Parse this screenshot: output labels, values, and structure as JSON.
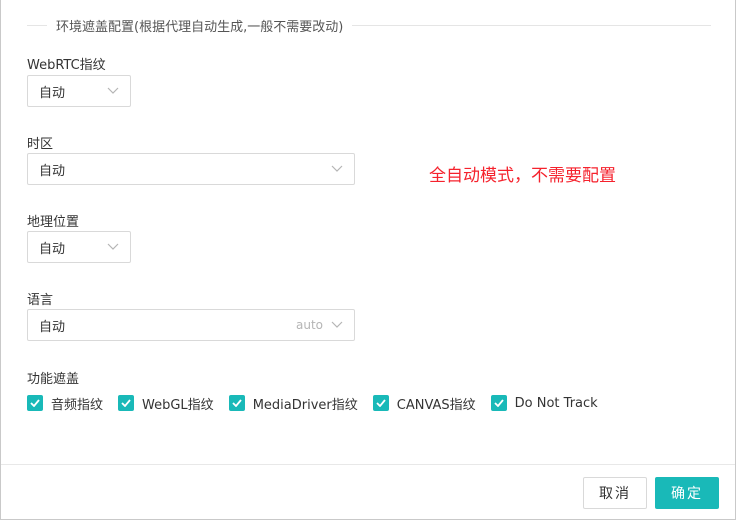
{
  "section": {
    "title": "环境遮盖配置(根据代理自动生成,一般不需要改动)"
  },
  "fields": {
    "webrtc": {
      "label": "WebRTC指纹",
      "value": "自动"
    },
    "timezone": {
      "label": "时区",
      "value": "自动"
    },
    "geo": {
      "label": "地理位置",
      "value": "自动"
    },
    "language": {
      "label": "语言",
      "value": "自动",
      "suffix": "auto"
    }
  },
  "note": "全自动模式，不需要配置",
  "features": {
    "label": "功能遮盖",
    "items": [
      {
        "label": "音频指纹",
        "checked": true
      },
      {
        "label": "WebGL指纹",
        "checked": true
      },
      {
        "label": "MediaDriver指纹",
        "checked": true
      },
      {
        "label": "CANVAS指纹",
        "checked": true
      },
      {
        "label": "Do Not Track",
        "checked": true
      }
    ]
  },
  "buttons": {
    "cancel": "取消",
    "ok": "确定"
  },
  "colors": {
    "accent": "#19b9b8",
    "note": "#f5222d"
  }
}
